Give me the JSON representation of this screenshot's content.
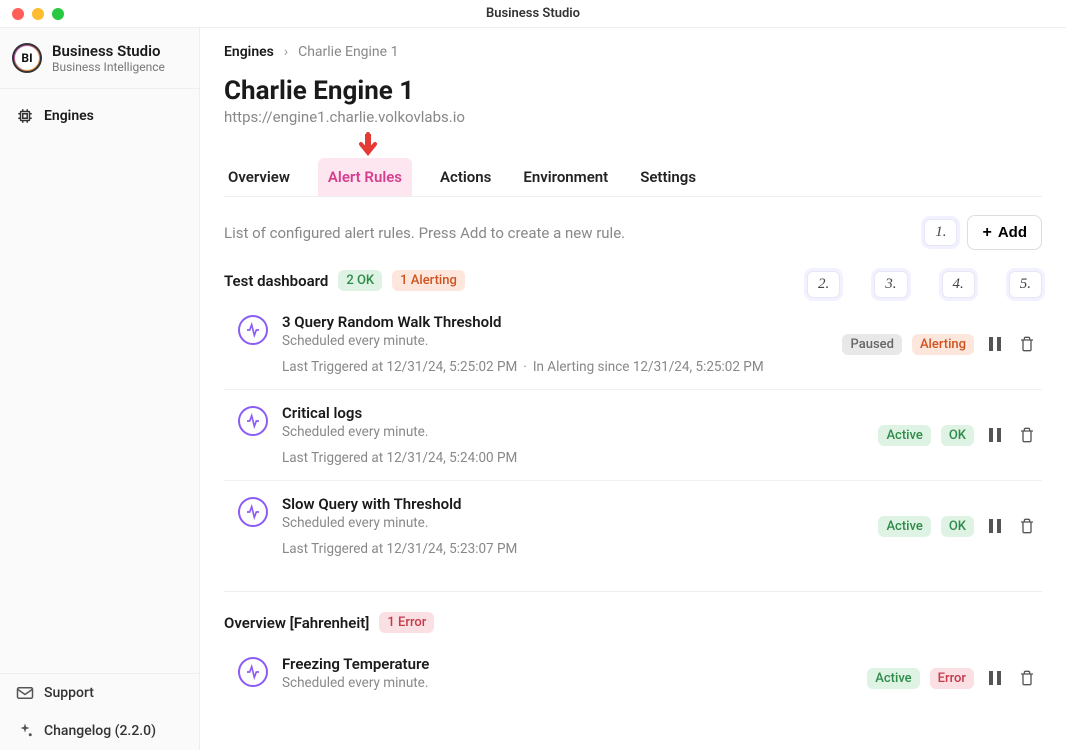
{
  "window": {
    "title": "Business Studio"
  },
  "brand": {
    "name": "Business Studio",
    "tagline": "Business Intelligence",
    "logo_text": "BI"
  },
  "nav": {
    "engines": "Engines"
  },
  "footer_nav": {
    "support": "Support",
    "changelog": "Changelog (2.2.0)"
  },
  "breadcrumb": {
    "root": "Engines",
    "leaf": "Charlie Engine 1"
  },
  "page": {
    "title": "Charlie Engine 1",
    "url": "https://engine1.charlie.volkovlabs.io"
  },
  "tabs": {
    "overview": "Overview",
    "alert_rules": "Alert Rules",
    "actions": "Actions",
    "environment": "Environment",
    "settings": "Settings"
  },
  "list": {
    "description": "List of configured alert rules. Press Add to create a new rule.",
    "add_label": "Add"
  },
  "callouts": {
    "c1": "1.",
    "c2": "2.",
    "c3": "3.",
    "c4": "4.",
    "c5": "5."
  },
  "dashboards": [
    {
      "name": "Test dashboard",
      "summary": [
        {
          "text": "2 OK",
          "kind": "ok"
        },
        {
          "text": "1 Alerting",
          "kind": "alerting"
        }
      ],
      "rules": [
        {
          "name": "3 Query Random Walk Threshold",
          "schedule": "Scheduled every minute.",
          "last_triggered": "Last Triggered at 12/31/24, 5:25:02 PM",
          "alerting_since": "In Alerting since 12/31/24, 5:25:02 PM",
          "status1": {
            "text": "Paused",
            "kind": "paused"
          },
          "status2": {
            "text": "Alerting",
            "kind": "alerting-s"
          },
          "show_callouts": true
        },
        {
          "name": "Critical logs",
          "schedule": "Scheduled every minute.",
          "last_triggered": "Last Triggered at 12/31/24, 5:24:00 PM",
          "alerting_since": "",
          "status1": {
            "text": "Active",
            "kind": "active"
          },
          "status2": {
            "text": "OK",
            "kind": "okstat"
          },
          "show_callouts": false
        },
        {
          "name": "Slow Query with Threshold",
          "schedule": "Scheduled every minute.",
          "last_triggered": "Last Triggered at 12/31/24, 5:23:07 PM",
          "alerting_since": "",
          "status1": {
            "text": "Active",
            "kind": "active"
          },
          "status2": {
            "text": "OK",
            "kind": "okstat"
          },
          "show_callouts": false
        }
      ]
    },
    {
      "name": "Overview [Fahrenheit]",
      "summary": [
        {
          "text": "1 Error",
          "kind": "error"
        }
      ],
      "rules": [
        {
          "name": "Freezing Temperature",
          "schedule": "Scheduled every minute.",
          "last_triggered": "",
          "alerting_since": "",
          "status1": {
            "text": "Active",
            "kind": "active"
          },
          "status2": {
            "text": "Error",
            "kind": "error"
          },
          "show_callouts": false
        }
      ]
    }
  ]
}
